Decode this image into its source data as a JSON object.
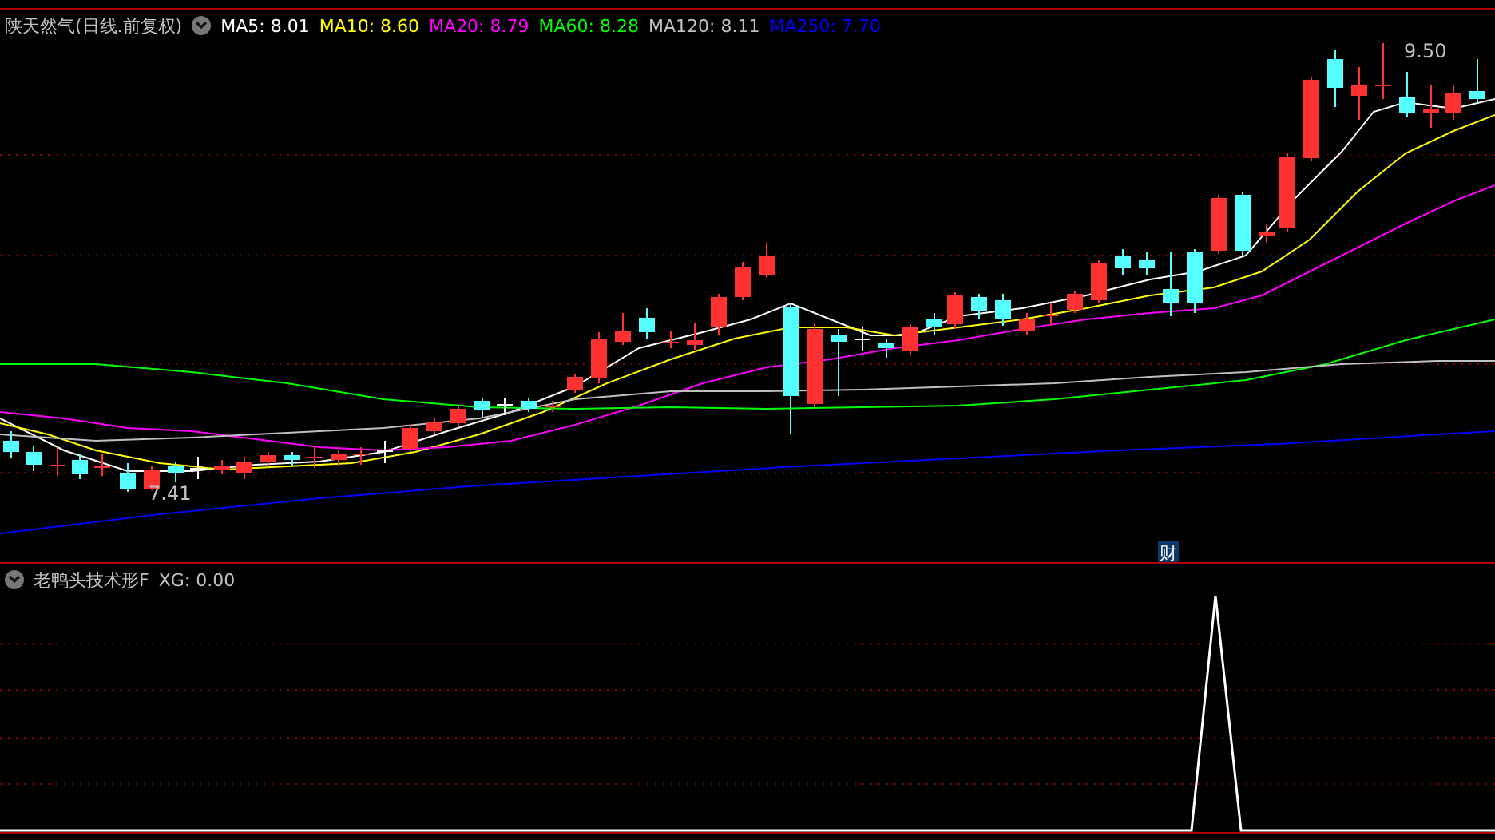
{
  "main_chart": {
    "title": "陕天然气(日线.前复权)",
    "indicators": [
      {
        "label": "MA5:",
        "value": "8.01",
        "color": "#ffffff"
      },
      {
        "label": "MA10:",
        "value": "8.60",
        "color": "#ffff00"
      },
      {
        "label": "MA20:",
        "value": "8.79",
        "color": "#ff00ff"
      },
      {
        "label": "MA60:",
        "value": "8.28",
        "color": "#00ff00"
      },
      {
        "label": "MA120:",
        "value": "8.11",
        "color": "#c0c0c0"
      },
      {
        "label": "MA250:",
        "value": "7.70",
        "color": "#0000ff"
      }
    ],
    "high_label": "9.50",
    "low_label": "7.41",
    "badge": "财"
  },
  "sub_chart": {
    "title": "老鸭头技术形F",
    "indicators": [
      {
        "label": "XG:",
        "value": "0.00",
        "color": "#c0c0c0"
      }
    ]
  }
}
